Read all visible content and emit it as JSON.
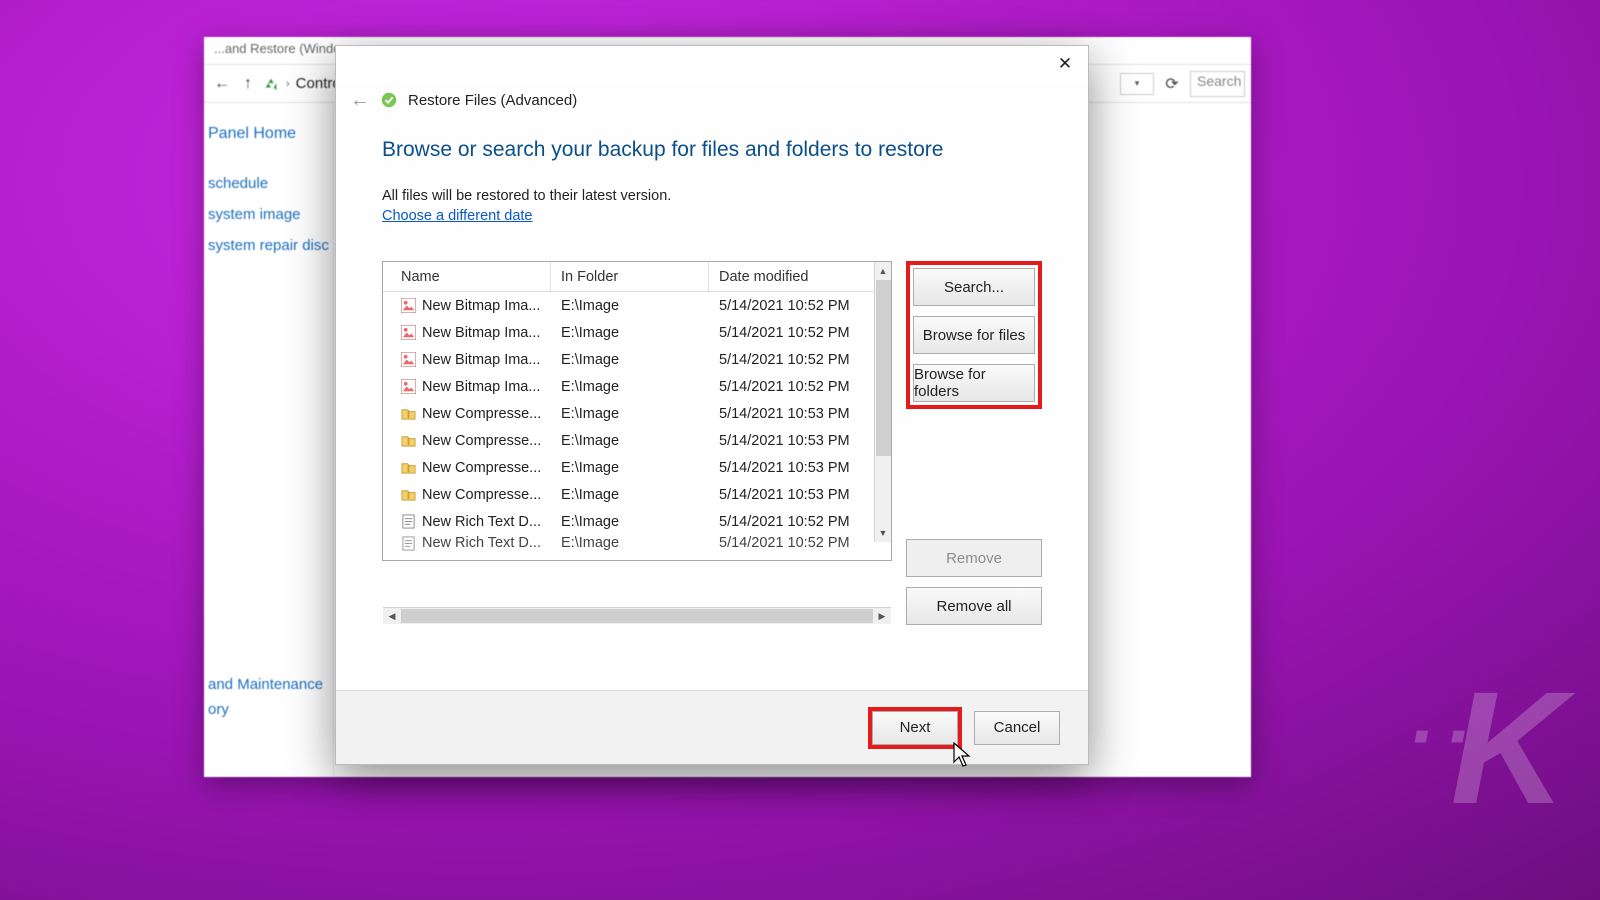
{
  "bg": {
    "title": "...and Restore (Window...",
    "crumb": "Contro...",
    "search_placeholder": "Search",
    "panel_home": "Panel Home",
    "links": [
      "schedule",
      "system image",
      "system repair disc"
    ],
    "footer_links": [
      "and Maintenance",
      "ory"
    ]
  },
  "dialog": {
    "title": "Restore Files (Advanced)",
    "heading": "Browse or search your backup for files and folders to restore",
    "subtext": "All files will be restored to their latest version.",
    "choose_link": "Choose a different date",
    "columns": {
      "name": "Name",
      "folder": "In Folder",
      "date": "Date modified"
    },
    "rows": [
      {
        "icon": "bitmap",
        "name": "New Bitmap Ima...",
        "folder": "E:\\Image",
        "date": "5/14/2021 10:52 PM"
      },
      {
        "icon": "bitmap",
        "name": "New Bitmap Ima...",
        "folder": "E:\\Image",
        "date": "5/14/2021 10:52 PM"
      },
      {
        "icon": "bitmap",
        "name": "New Bitmap Ima...",
        "folder": "E:\\Image",
        "date": "5/14/2021 10:52 PM"
      },
      {
        "icon": "bitmap",
        "name": "New Bitmap Ima...",
        "folder": "E:\\Image",
        "date": "5/14/2021 10:52 PM"
      },
      {
        "icon": "zip",
        "name": "New Compresse...",
        "folder": "E:\\Image",
        "date": "5/14/2021 10:53 PM"
      },
      {
        "icon": "zip",
        "name": "New Compresse...",
        "folder": "E:\\Image",
        "date": "5/14/2021 10:53 PM"
      },
      {
        "icon": "zip",
        "name": "New Compresse...",
        "folder": "E:\\Image",
        "date": "5/14/2021 10:53 PM"
      },
      {
        "icon": "zip",
        "name": "New Compresse...",
        "folder": "E:\\Image",
        "date": "5/14/2021 10:53 PM"
      },
      {
        "icon": "txt",
        "name": "New Rich Text D...",
        "folder": "E:\\Image",
        "date": "5/14/2021 10:52 PM"
      }
    ],
    "buttons": {
      "search": "Search...",
      "browse_files": "Browse for files",
      "browse_folders": "Browse for folders",
      "remove": "Remove",
      "remove_all": "Remove all",
      "next": "Next",
      "cancel": "Cancel"
    }
  }
}
